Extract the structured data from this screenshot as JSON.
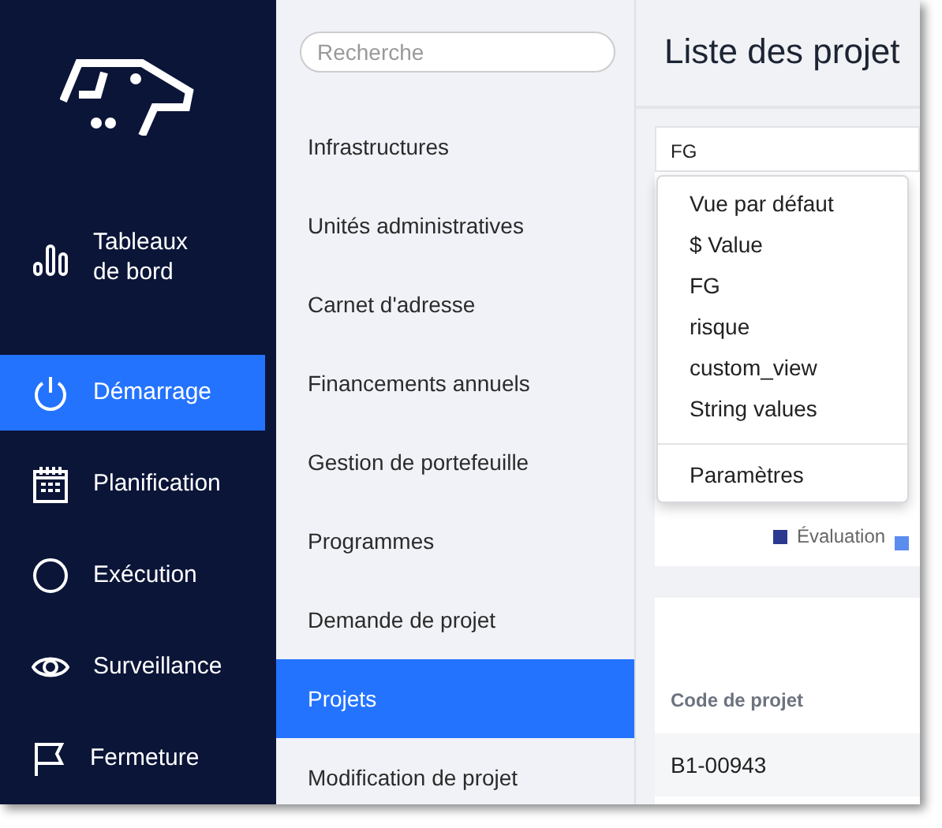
{
  "nav": {
    "items": [
      {
        "label": "Tableaux de bord",
        "kind": "chart",
        "selected": false
      },
      {
        "label": "Démarrage",
        "kind": "power",
        "selected": true
      },
      {
        "label": "Planification",
        "kind": "calendar",
        "selected": false
      },
      {
        "label": "Exécution",
        "kind": "circle",
        "selected": false
      },
      {
        "label": "Surveillance",
        "kind": "eye",
        "selected": false
      },
      {
        "label": "Fermeture",
        "kind": "flag",
        "selected": false
      }
    ]
  },
  "subnav": {
    "search": {
      "placeholder": "Recherche"
    },
    "items": [
      {
        "label": "Infrastructures",
        "selected": false
      },
      {
        "label": "Unités administratives",
        "selected": false
      },
      {
        "label": "Carnet d'adresse",
        "selected": false
      },
      {
        "label": "Financements annuels",
        "selected": false
      },
      {
        "label": "Gestion de portefeuille",
        "selected": false
      },
      {
        "label": "Programmes",
        "selected": false
      },
      {
        "label": "Demande de projet",
        "selected": false
      },
      {
        "label": "Projets",
        "selected": true
      },
      {
        "label": "Modification de projet",
        "selected": false
      }
    ]
  },
  "page": {
    "title": "Liste des projet",
    "view_select": {
      "value": "FG"
    },
    "dropdown": {
      "items": [
        {
          "label": "Vue par défaut",
          "kind": "option"
        },
        {
          "label": "$ Value",
          "kind": "option"
        },
        {
          "label": "FG",
          "kind": "option"
        },
        {
          "label": "risque",
          "kind": "option"
        },
        {
          "label": "custom_view",
          "kind": "option"
        },
        {
          "label": "String values",
          "kind": "option"
        },
        {
          "label": "Paramètres",
          "kind": "settings"
        }
      ]
    },
    "legend": [
      {
        "label": "Évaluation",
        "color": "#2b3990"
      },
      {
        "color": "#5b8def"
      }
    ],
    "table": {
      "columns": [
        "Code de projet"
      ],
      "rows": [
        [
          "B1-00943"
        ]
      ]
    }
  }
}
